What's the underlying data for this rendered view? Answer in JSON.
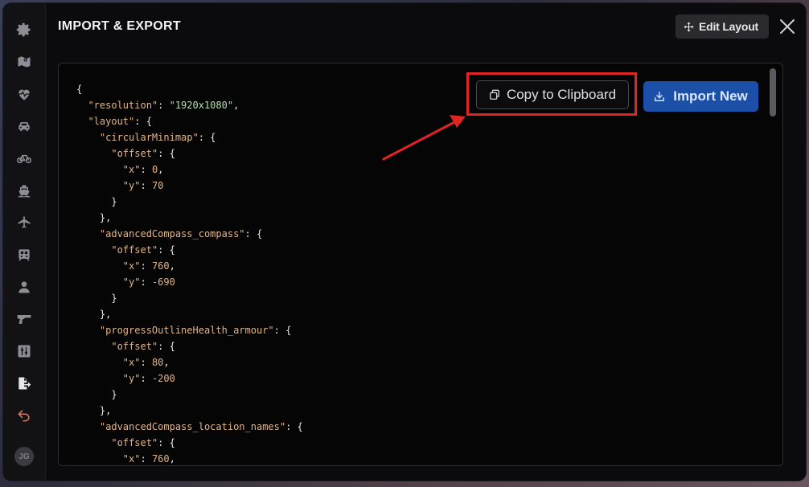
{
  "window": {
    "title": "IMPORT & EXPORT",
    "edit_layout_label": "Edit Layout"
  },
  "sidebar": {
    "items": [
      {
        "icon": "gear-icon"
      },
      {
        "icon": "map-icon"
      },
      {
        "icon": "heartbeat-icon"
      },
      {
        "icon": "car-icon"
      },
      {
        "icon": "bicycle-icon"
      },
      {
        "icon": "boat-icon"
      },
      {
        "icon": "plane-icon"
      },
      {
        "icon": "train-icon"
      },
      {
        "icon": "user-icon"
      },
      {
        "icon": "gun-icon"
      },
      {
        "icon": "sliders-icon"
      },
      {
        "icon": "file-export-icon"
      },
      {
        "icon": "undo-icon"
      }
    ],
    "avatar_initials": "JG"
  },
  "actions": {
    "copy_label": "Copy to Clipboard",
    "import_label": "Import New"
  },
  "code_lines": [
    "{",
    "  \"resolution\": \"1920x1080\",",
    "  \"layout\": {",
    "    \"circularMinimap\": {",
    "      \"offset\": {",
    "        \"x\": 0,",
    "        \"y\": 70",
    "      }",
    "    },",
    "    \"advancedCompass_compass\": {",
    "      \"offset\": {",
    "        \"x\": 760,",
    "        \"y\": -690",
    "      }",
    "    },",
    "    \"progressOutlineHealth_armour\": {",
    "      \"offset\": {",
    "        \"x\": 80,",
    "        \"y\": -200",
    "      }",
    "    },",
    "    \"advancedCompass_location_names\": {",
    "      \"offset\": {",
    "        \"x\": 760,"
  ],
  "colors": {
    "accent_blue": "#1b4fa8",
    "highlight_red": "#e02424",
    "undo_orange": "#e0704a"
  }
}
